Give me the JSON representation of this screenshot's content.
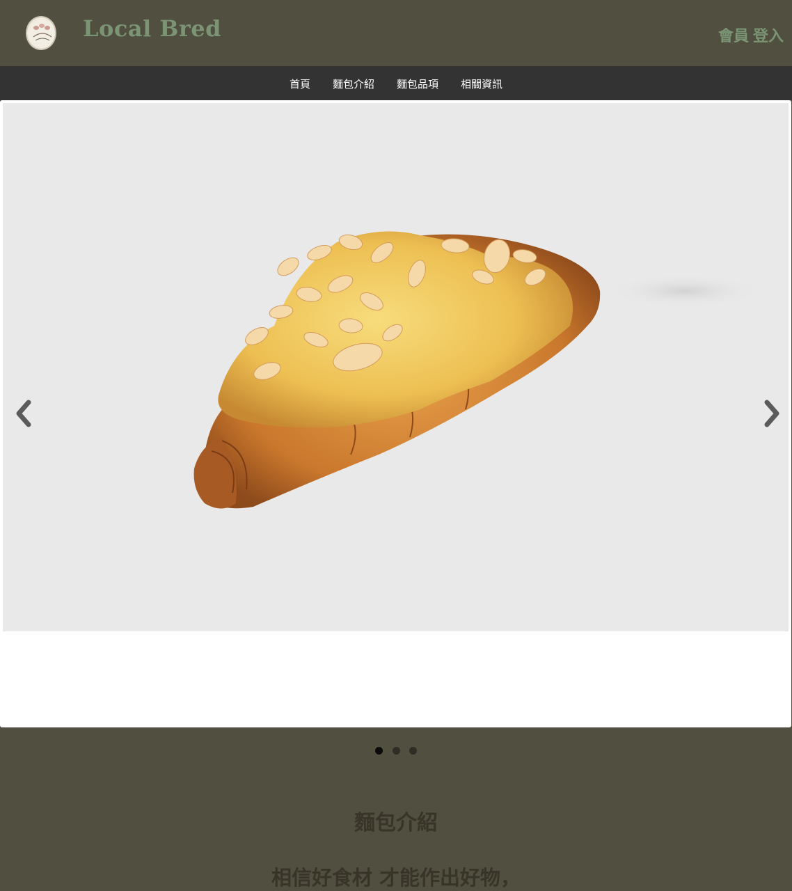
{
  "header": {
    "brand": "Local Bred",
    "member_label": "會員",
    "login_label": "登入",
    "logo_icon": "local-bakery-logo-icon"
  },
  "nav": {
    "items": [
      {
        "label": "首頁"
      },
      {
        "label": "麵包介紹"
      },
      {
        "label": "麵包品項"
      },
      {
        "label": "相關資訊"
      }
    ]
  },
  "carousel": {
    "slide_image": "almond-croissant",
    "prev_icon": "chevron-left-icon",
    "next_icon": "chevron-right-icon",
    "slide_count": 3,
    "active_index": 0
  },
  "section": {
    "title": "麵包介紹",
    "text": "相信好食材 才能作出好物，"
  },
  "colors": {
    "header_bg": "#514f3f",
    "nav_bg": "#333333",
    "accent_green": "#7b9574",
    "slide_bg": "#e9e9e9"
  }
}
